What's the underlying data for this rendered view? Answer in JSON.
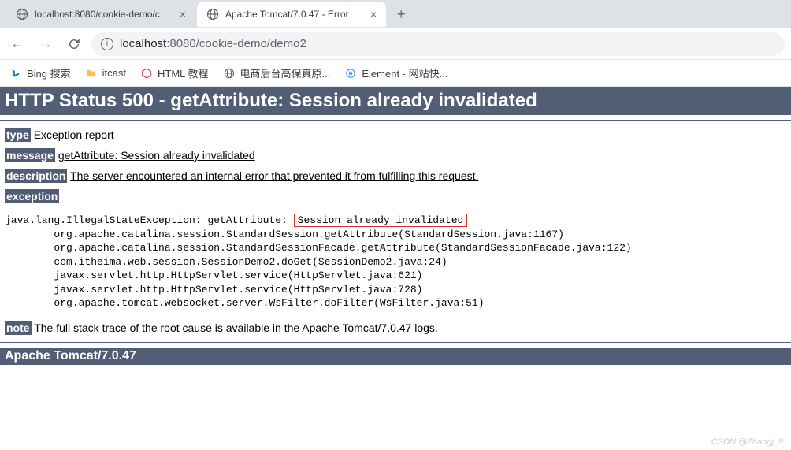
{
  "tabs": [
    {
      "title": "localhost:8080/cookie-demo/c",
      "favicon": "globe"
    },
    {
      "title": "Apache Tomcat/7.0.47 - Error",
      "favicon": "globe"
    }
  ],
  "url": {
    "host": "localhost",
    "port": ":8080",
    "path": "/cookie-demo/demo2"
  },
  "bookmarks": [
    {
      "icon": "bing",
      "label": "Bing 搜索"
    },
    {
      "icon": "folder",
      "label": "itcast"
    },
    {
      "icon": "red-hex",
      "label": "HTML 教程"
    },
    {
      "icon": "globe-gray",
      "label": "电商后台高保真原..."
    },
    {
      "icon": "element",
      "label": "Element - 网站快..."
    }
  ],
  "errorPage": {
    "statusHeader": "HTTP Status 500 - getAttribute: Session already invalidated",
    "typeLabel": "type",
    "typeValue": "Exception report",
    "messageLabel": "message",
    "messageValue": "getAttribute: Session already invalidated",
    "descriptionLabel": "description",
    "descriptionValue": "The server encountered an internal error that prevented it from fulfilling this request.",
    "exceptionLabel": "exception",
    "stackPrefix": "java.lang.IllegalStateException: getAttribute: ",
    "stackHighlight": "Session already invalidated",
    "stackLines": [
      "        org.apache.catalina.session.StandardSession.getAttribute(StandardSession.java:1167)",
      "        org.apache.catalina.session.StandardSessionFacade.getAttribute(StandardSessionFacade.java:122)",
      "        com.itheima.web.session.SessionDemo2.doGet(SessionDemo2.java:24)",
      "        javax.servlet.http.HttpServlet.service(HttpServlet.java:621)",
      "        javax.servlet.http.HttpServlet.service(HttpServlet.java:728)",
      "        org.apache.tomcat.websocket.server.WsFilter.doFilter(WsFilter.java:51)"
    ],
    "noteLabel": "note",
    "noteValue": "The full stack trace of the root cause is available in the Apache Tomcat/7.0.47 logs.",
    "footerVersion": "Apache Tomcat/7.0.47"
  },
  "watermark": "CSDN @Zhangj_9"
}
